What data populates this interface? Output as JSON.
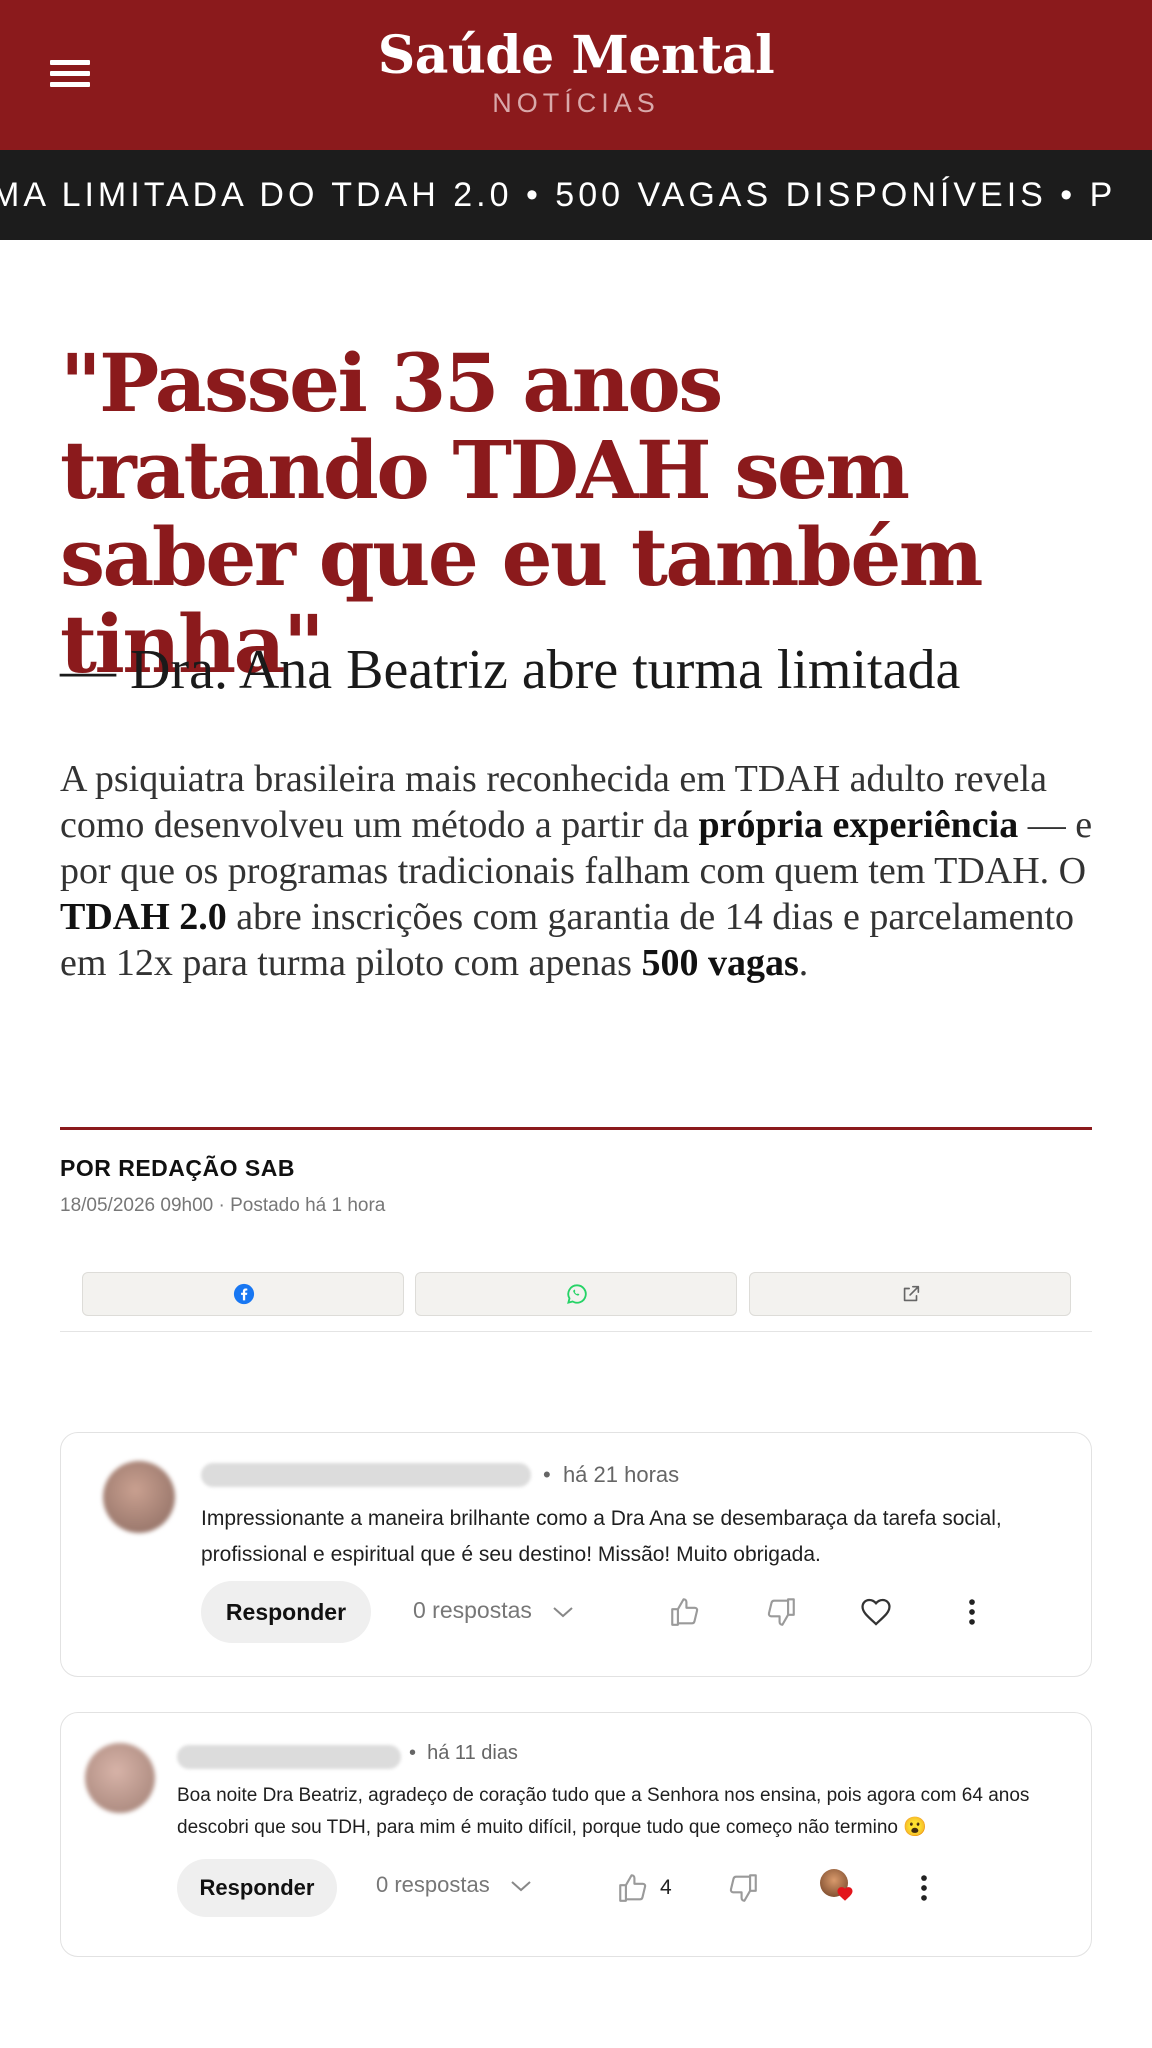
{
  "header": {
    "brand": "Saúde Mental",
    "sub": "NOTÍCIAS",
    "menu_icon": "hamburger-menu-icon",
    "bg_color": "#8b1a1c"
  },
  "ticker": {
    "text": "MA LIMITADA DO TDAH 2.0  •  500 VAGAS DISPONÍVEIS  •  P"
  },
  "article": {
    "headline": "\"Passei 35 anos tratando TDAH sem saber que eu também tinha\"",
    "subtitle": "— Dra. Ana Beatriz abre turma limitada",
    "lead": {
      "p1": "A psiquiatra brasileira mais reconhecida em TDAH adulto revela como desenvolveu um método a partir da ",
      "b1": "própria experiência",
      "p2": " — e por que os programas tradicionais falham com quem tem TDAH. O ",
      "b2": "TDAH 2.0",
      "p3": " abre inscrições com garantia de 14 dias e parcelamento em 12x para turma piloto com apenas ",
      "b3": "500 vagas",
      "p4": "."
    },
    "byline": "POR REDAÇÃO SAB",
    "dateline": "18/05/2026 09h00 · Postado há 1 hora"
  },
  "share": {
    "icons": [
      "facebook-icon",
      "whatsapp-icon",
      "external-link-icon"
    ]
  },
  "comments": [
    {
      "time": "há 21 horas",
      "text": "Impressionante a maneira brilhante como a Dra Ana se desembaraça da tarefa social, profissional e espiritual que é seu destino! Missão! Muito  obrigada.",
      "reply_label": "Responder",
      "replies_label": "0 respostas"
    },
    {
      "time": "há 11 dias",
      "text": "Boa noite Dra Beatriz, agradeço de coração tudo que a Senhora nos ensina, pois agora com 64 anos descobri que sou TDH, para mim é muito difícil, porque tudo que começo não termino 😮",
      "reply_label": "Responder",
      "replies_label": "0 respostas",
      "likes": "4"
    }
  ]
}
